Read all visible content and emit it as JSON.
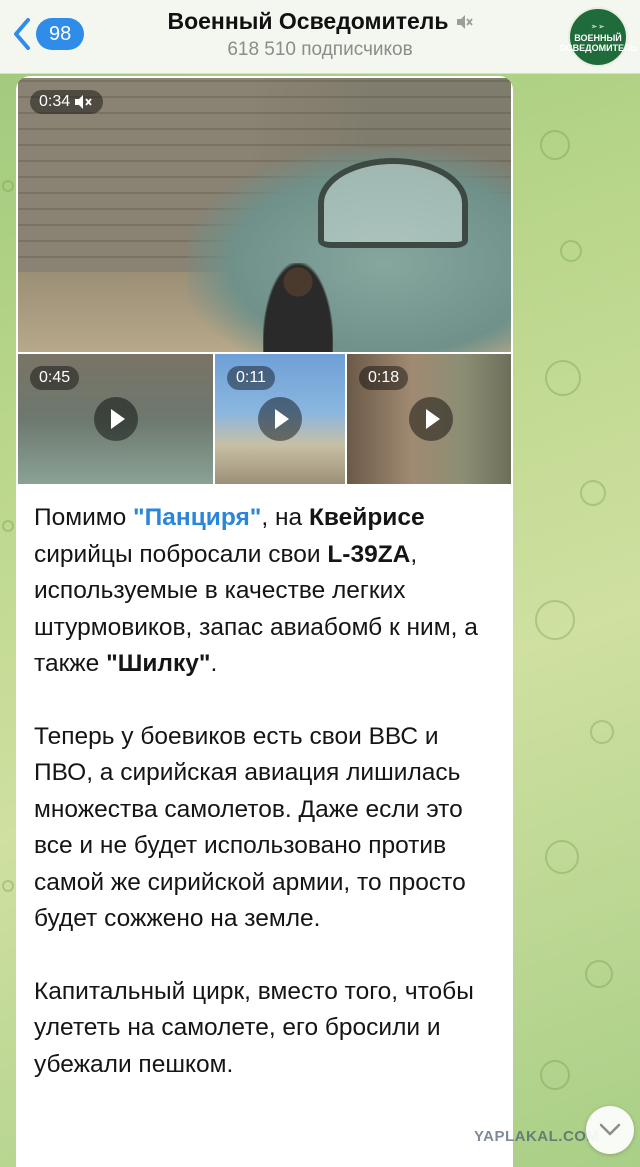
{
  "header": {
    "back_count": "98",
    "channel_title": "Военный Осведомитель",
    "subscribers": "618 510 подписчиков",
    "avatar": {
      "top": "➣➢",
      "line1": "ВОЕННЫЙ",
      "line2": "ОСВЕДОМИТЕЛЬ"
    },
    "mute_icon": "speaker-muted-icon"
  },
  "media": {
    "main": {
      "duration": "0:34",
      "sound_icon": "speaker-muted-icon"
    },
    "tiles": [
      {
        "duration": "0:45"
      },
      {
        "duration": "0:11"
      },
      {
        "duration": "0:18"
      }
    ]
  },
  "message": {
    "p1_a": "Помимо ",
    "p1_b": "\"Панциря\"",
    "p1_c": ", на ",
    "p1_d": "Квейрисе",
    "p1_e": " сирийцы побросали свои ",
    "p1_f": "L-39ZA",
    "p1_g": ", используемые в качестве легких штурмовиков, запас авиабомб к ним, а также ",
    "p1_h": "\"Шилку\"",
    "p1_i": ".",
    "p2": "Теперь у боевиков есть свои ВВС и ПВО, а сирийская авиация лишилась множества самолетов. Даже если это все и не будет использовано против самой же сирийской армии, то просто будет сожжено на земле.",
    "p3": "Капитальный цирк, вместо того, чтобы улететь на самолете, его бросили и убежали пешком."
  },
  "watermark": "YAPLAKAL.COM",
  "colors": {
    "accent": "#2f8ce8",
    "link": "#2a86d8"
  }
}
